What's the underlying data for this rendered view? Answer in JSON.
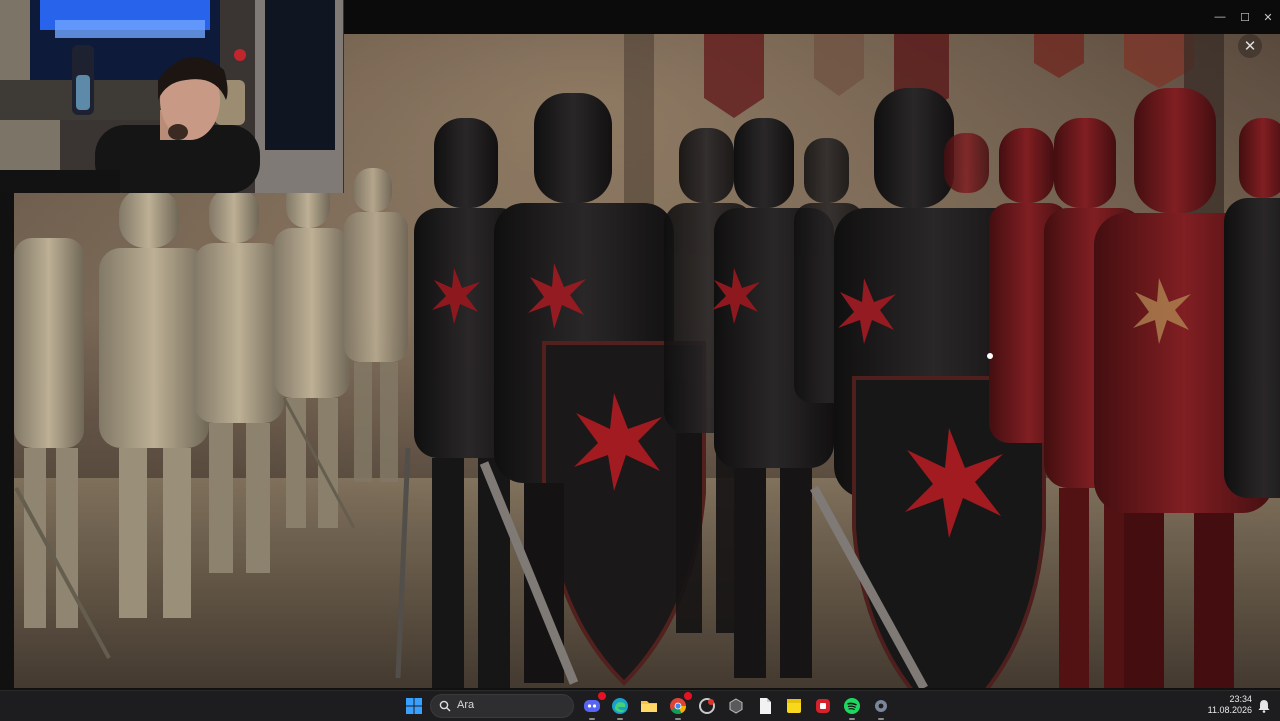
{
  "window": {
    "title": "",
    "controls": {
      "minimize": "—",
      "maximize": "☐",
      "close": "✕",
      "close_overlay": "✕"
    }
  },
  "artwork": {
    "subject": "knights-painting",
    "palette": {
      "silver": "#b8ab90",
      "black": "#1d1b1c",
      "red": "#7c1b1e",
      "crest": "#b01e24",
      "floor": "#8a7a63",
      "haze": "#a8917a"
    }
  },
  "webcam": {
    "subject": "streamer-webcam",
    "palette": {
      "light": "#2b6dff",
      "shirt": "#151515",
      "skin": "#c89a86",
      "hair": "#1c1512"
    }
  },
  "taskbar": {
    "search": {
      "label": "Ara",
      "icon": "search-icon"
    },
    "apps": [
      {
        "name": "start",
        "icon": "windows-logo-icon"
      },
      {
        "name": "discord",
        "icon": "discord-icon",
        "badge": ""
      },
      {
        "name": "edge",
        "icon": "edge-icon"
      },
      {
        "name": "file-explorer",
        "icon": "folder-icon"
      },
      {
        "name": "chrome",
        "icon": "chrome-icon"
      },
      {
        "name": "app5",
        "icon": "red-circle-app-icon"
      },
      {
        "name": "app6",
        "icon": "cube-app-icon"
      },
      {
        "name": "notepad",
        "icon": "document-icon"
      },
      {
        "name": "sticky-notes",
        "icon": "sticky-note-icon"
      },
      {
        "name": "app9",
        "icon": "red-app-icon"
      },
      {
        "name": "spotify",
        "icon": "spotify-icon"
      },
      {
        "name": "settings",
        "icon": "gear-icon"
      }
    ],
    "clock": {
      "time": "23:34",
      "date": "11.08.2026"
    },
    "accent": "#1e90ff"
  }
}
